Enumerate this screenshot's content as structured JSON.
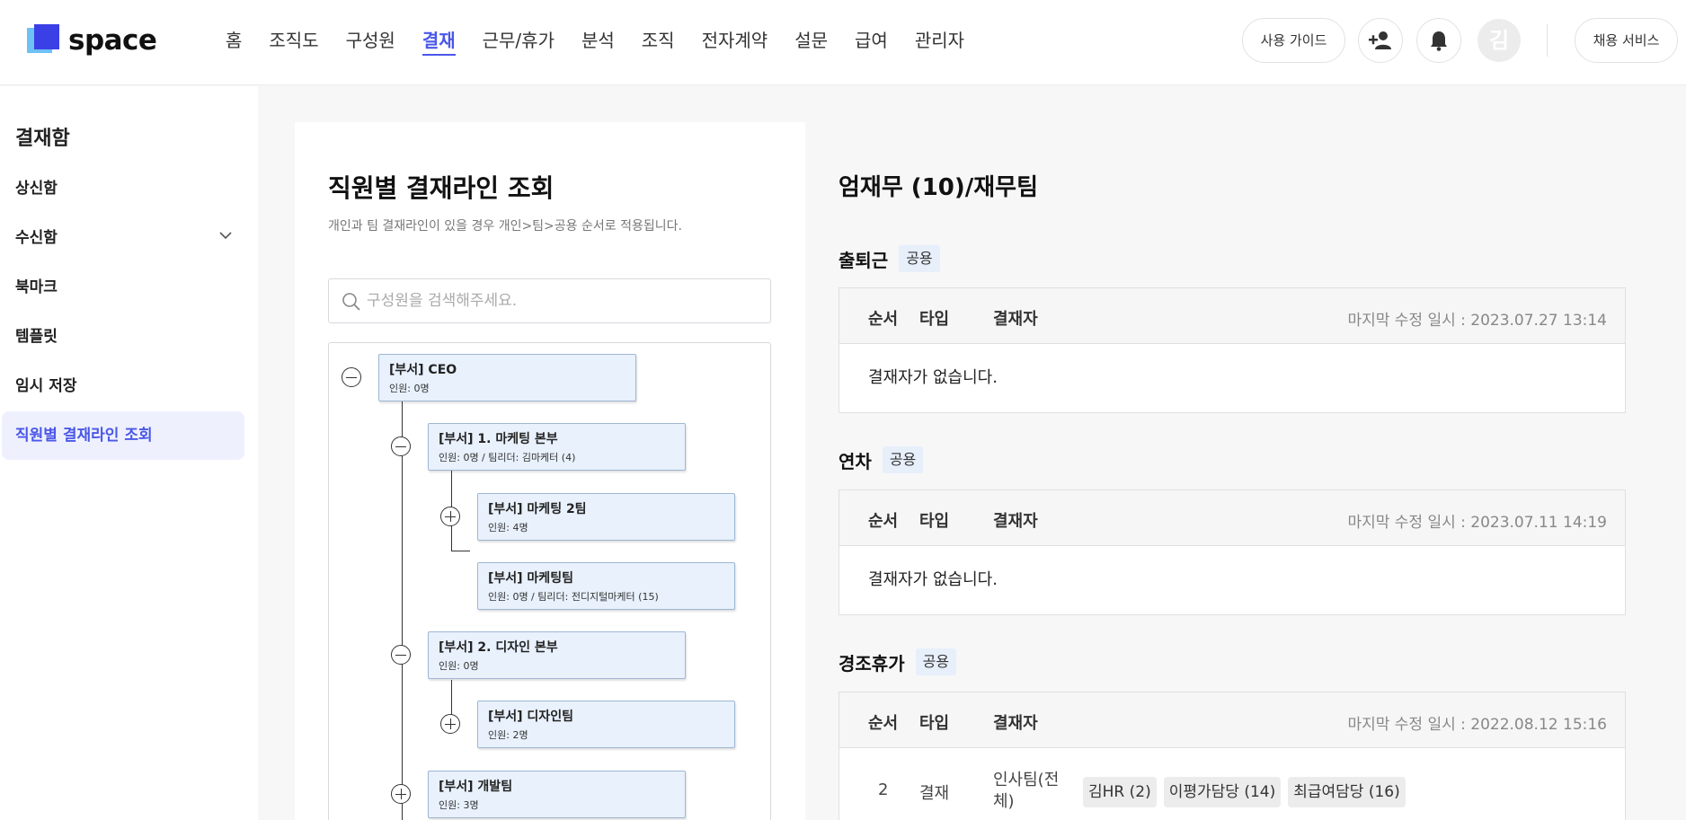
{
  "header": {
    "logo_text": "space",
    "nav": [
      "홈",
      "조직도",
      "구성원",
      "결재",
      "근무/휴가",
      "분석",
      "조직",
      "전자계약",
      "설문",
      "급여",
      "관리자"
    ],
    "active_nav": "결재",
    "guide_label": "사용 가이드",
    "avatar_initial": "김",
    "recruit_label": "채용 서비스",
    "accent_color": "#4a57e8"
  },
  "sidebar": {
    "title": "결재함",
    "items": [
      {
        "label": "상신함"
      },
      {
        "label": "수신함"
      },
      {
        "label": "북마크"
      },
      {
        "label": "템플릿"
      },
      {
        "label": "임시 저장"
      },
      {
        "label": "직원별 결재라인 조회"
      }
    ]
  },
  "left_panel": {
    "title": "직원별 결재라인 조회",
    "description": "개인과 팀 결재라인이 있을 경우 개인>팀>공용 순서로 적용됩니다.",
    "search_placeholder": "구성원을 검색해주세요.",
    "tree": [
      {
        "title": "[부서] CEO",
        "sub": "인원: 0명",
        "toggle": "minus"
      },
      {
        "title": "[부서] 1. 마케팅 본부",
        "sub": "인원: 0명 / 팀리더: 김마케터 (4)",
        "toggle": "minus"
      },
      {
        "title": "[부서] 마케팅 2팀",
        "sub": "인원: 4명",
        "toggle": "plus"
      },
      {
        "title": "[부서] 마케팅팀",
        "sub": "인원: 0명 / 팀리더: 전디지털마케터 (15)",
        "toggle": "none"
      },
      {
        "title": "[부서] 2. 디자인 본부",
        "sub": "인원: 0명",
        "toggle": "minus"
      },
      {
        "title": "[부서] 디자인팀",
        "sub": "인원: 2명",
        "toggle": "plus"
      },
      {
        "title": "[부서] 개발팀",
        "sub": "인원: 3명",
        "toggle": "plus"
      }
    ]
  },
  "right_panel": {
    "employee_title": "엄재무 (10)/재무팀",
    "columns": {
      "order": "순서",
      "type": "타입",
      "approver": "결재자"
    },
    "sections": [
      {
        "name": "출퇴근",
        "tag": "공용",
        "last_modified": "마지막 수정 일시 : 2023.07.27 13:14",
        "empty_text": "결재자가 없습니다."
      },
      {
        "name": "연차",
        "tag": "공용",
        "last_modified": "마지막 수정 일시 : 2023.07.11 14:19",
        "empty_text": "결재자가 없습니다."
      },
      {
        "name": "경조휴가",
        "tag": "공용",
        "last_modified": "마지막 수정 일시 : 2022.08.12 15:16",
        "rows": [
          {
            "order": "2",
            "type": "결재",
            "team": "인사팀(전체)",
            "approvers": [
              "김HR (2)",
              "이평가담당 (14)",
              "최급여담당 (16)"
            ]
          }
        ]
      }
    ]
  }
}
